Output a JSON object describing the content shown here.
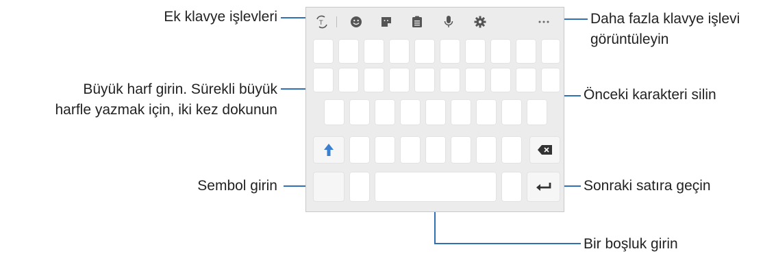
{
  "labels": {
    "extra_functions": "Ek klavye işlevleri",
    "more_functions_line1": "Daha fazla klavye işlevi",
    "more_functions_line2": "görüntüleyin",
    "capitalize_line1": "Büyük harf girin. Sürekli büyük",
    "capitalize_line2": "harfle yazmak için, iki kez dokunun",
    "delete_previous": "Önceki karakteri silin",
    "enter_symbols": "Sembol girin",
    "next_line": "Sonraki satıra geçin",
    "space": "Bir boşluk girin"
  },
  "toolbar_icons": [
    "translate-icon",
    "emoji-icon",
    "sticker-icon",
    "clipboard-icon",
    "microphone-icon",
    "gear-icon",
    "more-icon"
  ],
  "colors": {
    "callout_line": "#2f6fb5",
    "shift_arrow": "#3a7fd0",
    "keyboard_bg": "#ececec",
    "key_bg": "#ffffff"
  }
}
